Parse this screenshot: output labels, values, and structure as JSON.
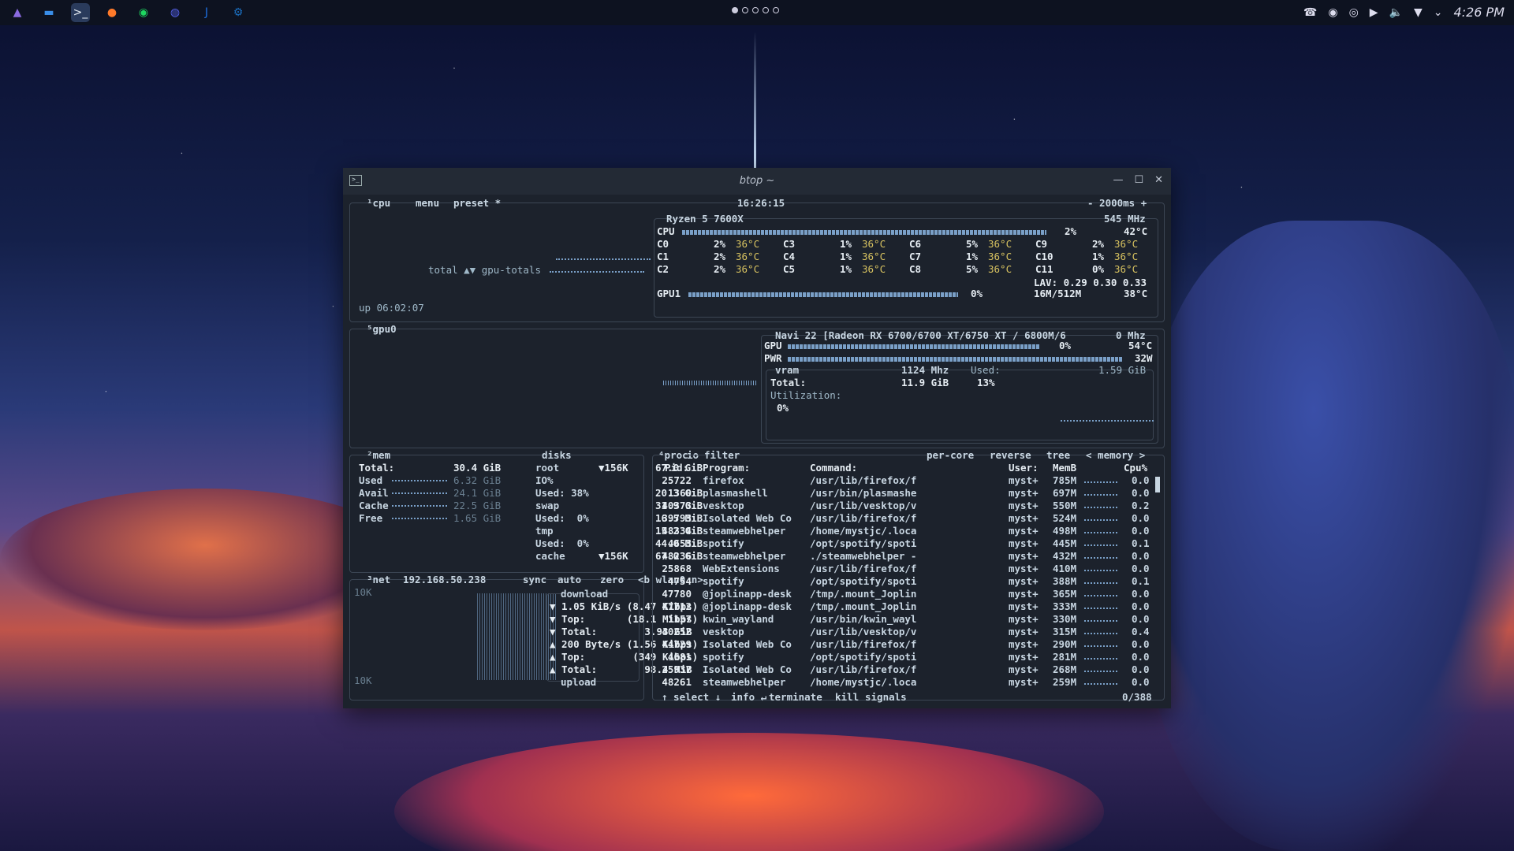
{
  "taskbar": {
    "apps": [
      {
        "icon": "app-launcher-icon",
        "glyph": "▲",
        "color": "#8a6ae0"
      },
      {
        "icon": "file-manager-icon",
        "glyph": "▬",
        "color": "#3a8ee8"
      },
      {
        "icon": "terminal-icon",
        "glyph": ">_",
        "color": "#e6edf3"
      },
      {
        "icon": "firefox-icon",
        "glyph": "●",
        "color": "#ff7a2a"
      },
      {
        "icon": "spotify-icon",
        "glyph": "◉",
        "color": "#1ed760"
      },
      {
        "icon": "discord-icon",
        "glyph": "◍",
        "color": "#5865f2"
      },
      {
        "icon": "joplin-icon",
        "glyph": "J",
        "color": "#1d6fe0"
      },
      {
        "icon": "steam-icon",
        "glyph": "⚙",
        "color": "#1b6fc0"
      }
    ],
    "clock": "4:26 PM"
  },
  "window": {
    "title": "btop ~"
  },
  "cpu": {
    "header_num": "¹",
    "header": "cpu",
    "menu": "menu",
    "preset": "preset *",
    "time": "16:26:15",
    "interval": "- 2000ms +",
    "model": "Ryzen 5 7600X",
    "freq": "545 MHz",
    "total_label": "total ▲▼ gpu-totals",
    "uptime": "up 06:02:07",
    "cpu_row": {
      "label": "CPU",
      "pct": "2%",
      "temp": "42°C"
    },
    "cores": [
      [
        "C0",
        "2%",
        "36°C"
      ],
      [
        "C1",
        "2%",
        "36°C"
      ],
      [
        "C2",
        "2%",
        "36°C"
      ],
      [
        "C3",
        "1%",
        "36°C"
      ],
      [
        "C4",
        "1%",
        "36°C"
      ],
      [
        "C5",
        "1%",
        "36°C"
      ],
      [
        "C6",
        "5%",
        "36°C"
      ],
      [
        "C7",
        "1%",
        "36°C"
      ],
      [
        "C8",
        "5%",
        "36°C"
      ],
      [
        "C9",
        "2%",
        "36°C"
      ],
      [
        "C10",
        "1%",
        "36°C"
      ],
      [
        "C11",
        "0%",
        "36°C"
      ]
    ],
    "lav": "LAV: 0.29 0.30 0.33",
    "gpu1": {
      "label": "GPU1",
      "pct": "0%",
      "mem": "16M/512M",
      "temp": "38°C"
    }
  },
  "gpu": {
    "header_num": "⁵",
    "header": "gpu0",
    "name": "Navi 22 [Radeon RX 6700/6700 XT/6750 XT / 6800M/6",
    "freq": "0 Mhz",
    "gpu_row": {
      "label": "GPU",
      "pct": "0%",
      "temp": "54°C"
    },
    "pwr_row": {
      "label": "PWR",
      "value": "32W"
    },
    "vram_label": "vram",
    "vram_freq": "1124 Mhz",
    "total_label": "Total:",
    "total": "11.9 GiB",
    "used_label": "Used:",
    "used": "1.59 GiB",
    "used_pct": "13%",
    "util_label": "Utilization:",
    "util": "0%"
  },
  "mem": {
    "header_num": "²",
    "header": "mem",
    "rows": [
      {
        "label": "Total:",
        "value": "30.4 GiB"
      },
      {
        "label": "Used",
        "value": "6.32 GiB"
      },
      {
        "label": "Avail",
        "value": "24.1 GiB"
      },
      {
        "label": "Cache",
        "value": "22.5 GiB"
      },
      {
        "label": "Free",
        "value": "1.65 GiB"
      }
    ]
  },
  "disks": {
    "header": "disks",
    "io": "io",
    "lines": [
      {
        "a": "root",
        "b": "▼156K",
        "c": "67.0 GiB"
      },
      {
        "a": "IO%",
        "b": "",
        "c": ""
      },
      {
        "a": "Used: 38%",
        "b": "",
        "c": "20.3 GiB"
      },
      {
        "a": "swap",
        "b": "",
        "c": "31.9 GiB"
      },
      {
        "a": "Used:  0%",
        "b": "",
        "c": "16.5 MiB"
      },
      {
        "a": "tmp",
        "b": "",
        "c": "15.2 GiB"
      },
      {
        "a": "Used:  0%",
        "b": "",
        "c": "44.0 MiB"
      },
      {
        "a": "cache",
        "b": "▼156K",
        "c": "67.0 GiB"
      }
    ]
  },
  "net": {
    "header_num": "³",
    "header": "net",
    "ip": "192.168.50.238",
    "sync": "sync",
    "auto": "auto",
    "zero": "zero",
    "iface": "<b wlan0 n>",
    "scale_top": "10K",
    "scale_bottom": "10K",
    "download": "download",
    "lines": [
      "▼ 1.05 KiB/s (8.47 Kibps)",
      "▼ Top:       (18.1 Mibps)",
      "▼ Total:        3.93 GiB",
      "▲ 200 Byte/s (1.56 Kibps)",
      "▲ Top:        (349 Kibps)",
      "▲ Total:        98.4 MiB"
    ],
    "upload": "upload"
  },
  "proc": {
    "header_num": "⁴",
    "header": "proc",
    "filter": "filter",
    "options": [
      "per-core",
      "reverse",
      "tree",
      "< memory >"
    ],
    "columns": {
      "pid": "Pid:",
      "program": "Program:",
      "command": "Command:",
      "user": "User:",
      "mem": "MemB",
      "cpu": "Cpu%"
    },
    "rows": [
      [
        "25722",
        "firefox",
        "/usr/lib/firefox/f",
        "myst+",
        "785M",
        "0.0"
      ],
      [
        "1360",
        "plasmashell",
        "/usr/bin/plasmashe",
        "myst+",
        "697M",
        "0.0"
      ],
      [
        "40373",
        "vesktop",
        "/usr/lib/vesktop/v",
        "myst+",
        "550M",
        "0.2"
      ],
      [
        "39793",
        "Isolated Web Co",
        "/usr/lib/firefox/f",
        "myst+",
        "524M",
        "0.0"
      ],
      [
        "48334",
        "steamwebhelper",
        "/home/mystjc/.loca",
        "myst+",
        "498M",
        "0.0"
      ],
      [
        "4653",
        "spotify",
        "/opt/spotify/spoti",
        "myst+",
        "445M",
        "0.1"
      ],
      [
        "48236",
        "steamwebhelper",
        "./steamwebhelper -",
        "myst+",
        "432M",
        "0.0"
      ],
      [
        "25868",
        "WebExtensions",
        "/usr/lib/firefox/f",
        "myst+",
        "410M",
        "0.0"
      ],
      [
        "4754",
        "spotify",
        "/opt/spotify/spoti",
        "myst+",
        "388M",
        "0.1"
      ],
      [
        "47780",
        "@joplinapp-desk",
        "/tmp/.mount_Joplin",
        "myst+",
        "365M",
        "0.0"
      ],
      [
        "47712",
        "@joplinapp-desk",
        "/tmp/.mount_Joplin",
        "myst+",
        "333M",
        "0.0"
      ],
      [
        "1157",
        "kwin_wayland",
        "/usr/bin/kwin_wayl",
        "myst+",
        "330M",
        "0.0"
      ],
      [
        "40252",
        "vesktop",
        "/usr/lib/vesktop/v",
        "myst+",
        "315M",
        "0.4"
      ],
      [
        "44729",
        "Isolated Web Co",
        "/usr/lib/firefox/f",
        "myst+",
        "290M",
        "0.0"
      ],
      [
        "4681",
        "spotify",
        "/opt/spotify/spoti",
        "myst+",
        "281M",
        "0.0"
      ],
      [
        "25937",
        "Isolated Web Co",
        "/usr/lib/firefox/f",
        "myst+",
        "268M",
        "0.0"
      ],
      [
        "48261",
        "steamwebhelper",
        "/home/mystjc/.loca",
        "myst+",
        "259M",
        "0.0"
      ]
    ],
    "footer": {
      "select": "↑ select ↓",
      "info": "info ↵",
      "terminate": "terminate",
      "kill": "kill",
      "signals": "signals",
      "count": "0/388"
    }
  }
}
